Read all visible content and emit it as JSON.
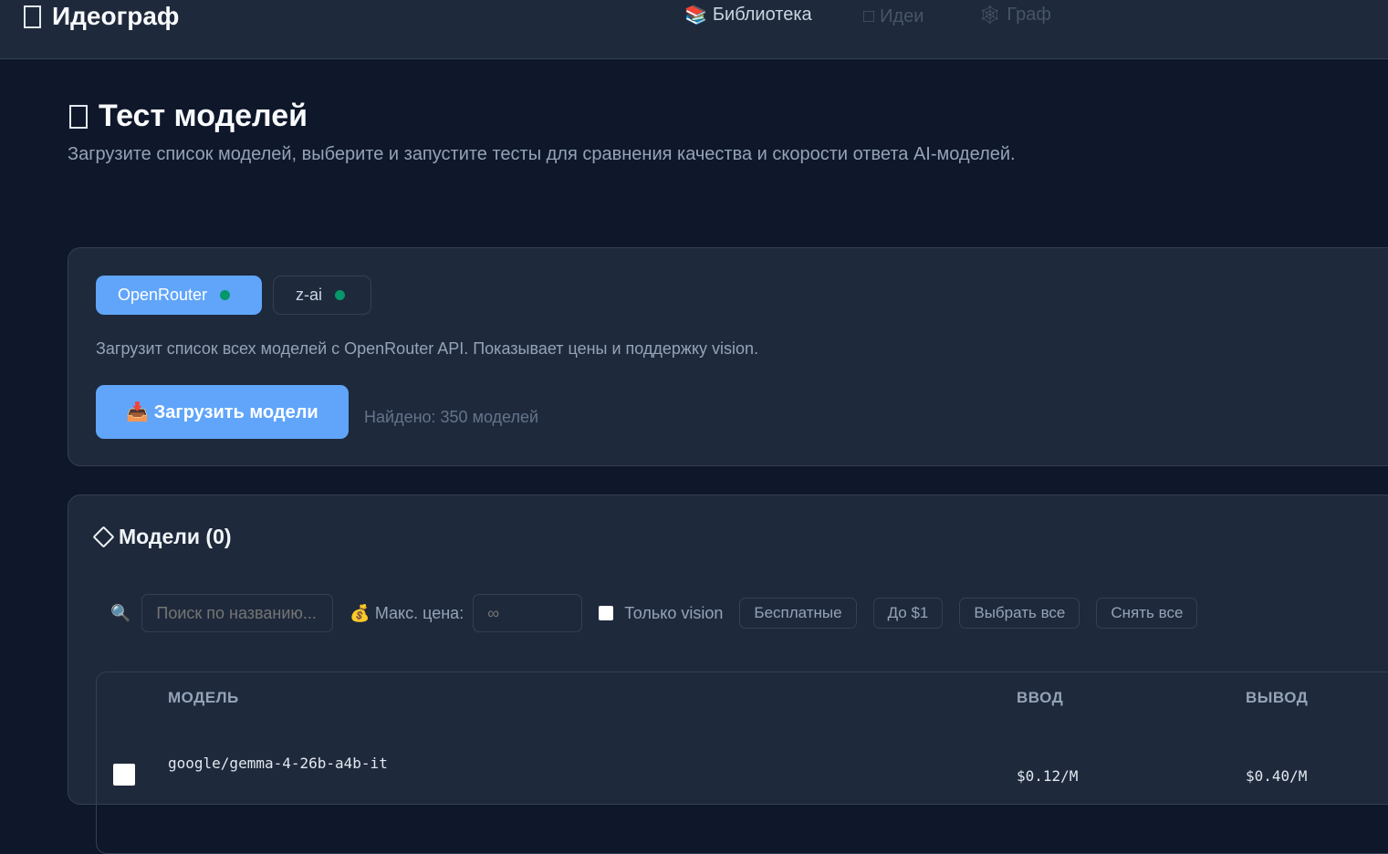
{
  "header": {
    "logo": "Идеограф",
    "nav": [
      {
        "icon": "📚",
        "label": "Библиотека"
      },
      {
        "icon": "□",
        "label": "Идеи"
      },
      {
        "icon": "🕸",
        "label": "Граф"
      }
    ]
  },
  "page": {
    "title": "Тест моделей",
    "subtitle": "Загрузите список моделей, выберите и запустите тесты для сравнения качества и скорости ответа AI-моделей."
  },
  "providers": {
    "tabs": [
      {
        "label": "OpenRouter",
        "active": true
      },
      {
        "label": "z-ai",
        "active": false
      }
    ],
    "description": "Загрузит список всех моделей с OpenRouter API. Показывает цены и поддержку vision.",
    "load_button": "📥 Загрузить модели",
    "found": "Найдено: 350 моделей"
  },
  "models": {
    "title": "Модели (0)",
    "search_placeholder": "Поиск по названию...",
    "max_price_label": "💰 Макс. цена:",
    "max_price_placeholder": "∞",
    "vision_label": "Только vision",
    "buttons": [
      "Бесплатные",
      "До $1",
      "Выбрать все",
      "Снять все"
    ],
    "columns": [
      "МОДЕЛЬ",
      "ВВОД",
      "ВЫВОД"
    ],
    "rows": [
      {
        "name": "google/gemma-4-26b-a4b-it",
        "input": "$0.12/M",
        "output": "$0.40/M"
      }
    ]
  }
}
